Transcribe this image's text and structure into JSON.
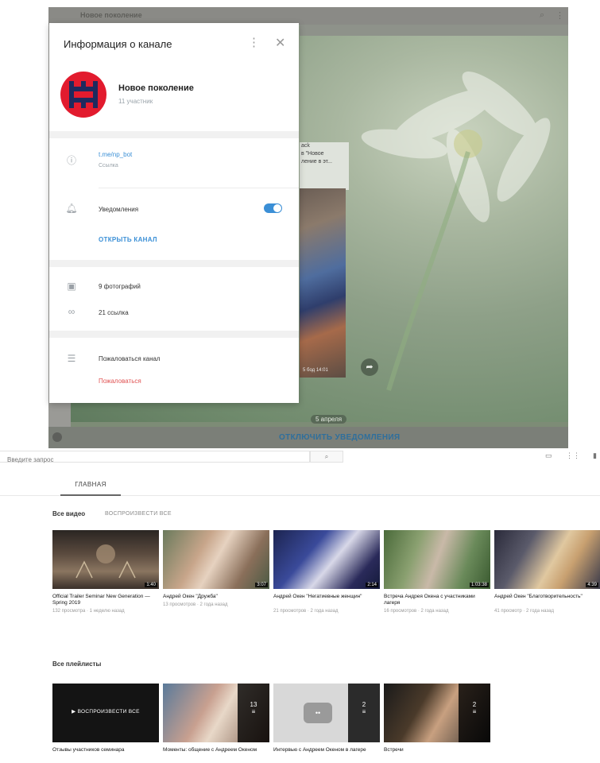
{
  "telegram": {
    "header_title": "Новое поколение",
    "panel": {
      "title": "Информация о канале",
      "channel_name": "Новое поколение",
      "members": "11 участник",
      "link_value": "t.me/np_bot",
      "link_caption": "Ссылка",
      "notifications_label": "Уведомления",
      "notifications_on": true,
      "open_channel": "ОТКРЫТЬ КАНАЛ",
      "photos": "9 фотографий",
      "links": "21 ссылка",
      "report_channel": "Пожаловаться канал",
      "report_action": "Пожаловаться"
    },
    "chat": {
      "message_lines": [
        "ack",
        "в \"Новое",
        "ление в эт..."
      ],
      "photo_meta": "5 бод  14:01",
      "date_pill": "5 апреля",
      "bottom_button": "ОТКЛЮЧИТЬ УВЕДОМЛЕНИЯ"
    }
  },
  "youtube": {
    "search_placeholder": "Введите запрос",
    "tab_main": "ГЛАВНАЯ",
    "videos_section_title": "Все видео",
    "videos_section_link": "ВОСПРОИЗВЕСТИ ВСЕ",
    "videos": [
      {
        "title": "Official Trailer Seminar New Generation — Spring 2019",
        "meta": "132 просмотра · 1 неделю назад",
        "duration": "1:40"
      },
      {
        "title": "Андрей Окен \"Дружба\"",
        "meta": "13 просмотров · 2 года назад",
        "duration": "3:07"
      },
      {
        "title": "Андрей Окен \"Негатиевные женщин\"",
        "meta": "21 просмотров · 2 года назад",
        "duration": "2:14"
      },
      {
        "title": "Встреча Андрея Окена с участниками лагеря",
        "meta": "16 просмотров · 2 года назад",
        "duration": "1:03:38"
      },
      {
        "title": "Андрей Окен \"Благотворительность\"",
        "meta": "41 просмотр · 2 года назад",
        "duration": "4:39"
      }
    ],
    "playlists_section_title": "Все плейлисты",
    "playlists": [
      {
        "title": "Отзывы участников семинара",
        "count": "",
        "play_all": "▶ ВОСПРОИЗВЕСТИ ВСЕ"
      },
      {
        "title": "Моменты: общение с Андреем Океном",
        "count": "13"
      },
      {
        "title": "Интервью с Андреем Океном в лагере",
        "count": "2"
      },
      {
        "title": "Встречи",
        "count": "2"
      }
    ]
  }
}
